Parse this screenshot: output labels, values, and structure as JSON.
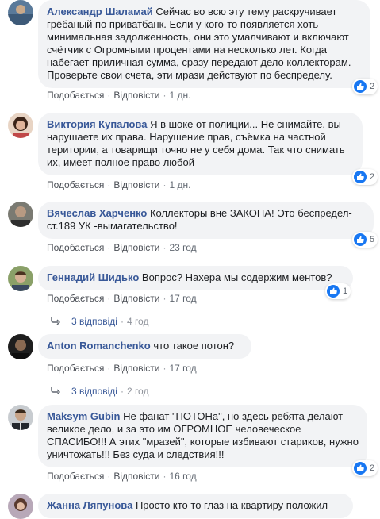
{
  "actions": {
    "like": "Подобається",
    "reply": "Відповісти"
  },
  "comments": [
    {
      "author": "Александр Шаламай",
      "text": "Сейчас во всю эту тему раскручивает грёбаный по приватбанк. Если у кого-то появляется хоть минимальная задолженность, они это умалчивают и включают счётчик с Огромными процентами на несколько лет. Когда набегает приличная сумма, сразу передают дело коллекторам. Проверьте свои счета, эти мрази действуют по беспределу.",
      "time": "1 дн.",
      "likes": "2"
    },
    {
      "author": "Виктория Купалова",
      "text": "Я в шоке от полиции... Не снимайте, вы нарушаете их права. Нарушение прав, съёмка на частной територии, а товарищи точно не у себя дома. Так что снимать их, имеет полное право любой",
      "time": "1 дн.",
      "likes": "2"
    },
    {
      "author": "Вячеслав Харченко",
      "text": "Коллекторы вне ЗАКОНА! Это беспредел- ст.189 УК -вымагательство!",
      "time": "23 год",
      "likes": "5"
    },
    {
      "author": "Геннадий Шидько",
      "text": "Вопрос? Нахера мы содержим ментов?",
      "time": "17 год",
      "likes": "1",
      "replies": "3 відповіді",
      "replies_age": "4 год"
    },
    {
      "author": "Anton Romanchenko",
      "text": "что такое потон?",
      "time": "17 год",
      "replies": "3 відповіді",
      "replies_age": "2 год"
    },
    {
      "author": "Maksym Gubin",
      "text": "Не фанат \"ПОТОНа\", но здесь ребята делают великое дело, и за это им ОГРОМНОЕ человеческое СПАСИБО!!! А этих \"мразей\", которые избивают стариков, нужно уничтожать!!! Без суда и следствия!!!",
      "time": "16 год",
      "likes": "2"
    },
    {
      "author": "Жанна Ляпунова",
      "text": "Просто кто то глаз на квартиру положил"
    }
  ],
  "colors": {
    "link": "#385898",
    "bubble": "#f2f3f5",
    "like": "#1877f2"
  },
  "icons": {
    "like": "thumbs-up-icon",
    "reply_arrow": "reply-arrow-icon"
  }
}
